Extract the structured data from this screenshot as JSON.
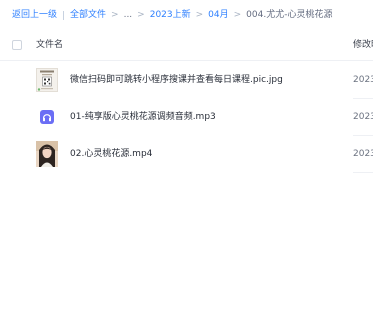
{
  "breadcrumb": {
    "back_label": "返回上一级",
    "all_files_label": "全部文件",
    "ellipsis": "...",
    "folder_2023": "2023上新",
    "folder_month": "04月",
    "current": "004.尤尤-心灵桃花源",
    "separator": ">"
  },
  "table": {
    "col_name": "文件名",
    "col_modified": "修改时",
    "rows": [
      {
        "name": "微信扫码即可跳转小程序搜课并查看每日课程.pic.jpg",
        "date": "2023",
        "icon": "image-thumbnail-icon"
      },
      {
        "name": "01-纯享版心灵桃花源调频音频.mp3",
        "date": "2023",
        "icon": "audio-file-icon"
      },
      {
        "name": "02.心灵桃花源.mp4",
        "date": "2023",
        "icon": "video-thumbnail-icon"
      }
    ]
  },
  "colors": {
    "link": "#2f80ff",
    "audio_icon": "#6b6ef5"
  }
}
